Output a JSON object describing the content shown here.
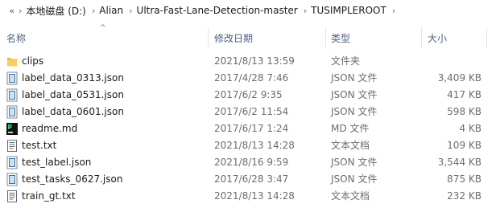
{
  "breadcrumb": {
    "start_glyph": "«",
    "separator": "›",
    "items": [
      "本地磁盘 (D:)",
      "Alian",
      "Ultra-Fast-Lane-Detection-master",
      "TUSIMPLEROOT"
    ],
    "chevron": "∨"
  },
  "columns": {
    "name": "名称",
    "date": "修改日期",
    "type": "类型",
    "size": "大小",
    "sort_glyph": "^"
  },
  "files": [
    {
      "name": "clips",
      "date": "2021/8/13 13:59",
      "type": "文件夹",
      "size": "",
      "icon": "folder-icon"
    },
    {
      "name": "label_data_0313.json",
      "date": "2017/4/28 7:46",
      "type": "JSON 文件",
      "size": "3,409 KB",
      "icon": "json-file-icon"
    },
    {
      "name": "label_data_0531.json",
      "date": "2017/6/2 9:35",
      "type": "JSON 文件",
      "size": "417 KB",
      "icon": "json-file-icon"
    },
    {
      "name": "label_data_0601.json",
      "date": "2017/6/2 11:54",
      "type": "JSON 文件",
      "size": "598 KB",
      "icon": "json-file-icon"
    },
    {
      "name": "readme.md",
      "date": "2017/6/17 1:24",
      "type": "MD 文件",
      "size": "4 KB",
      "icon": "pycharm-file-icon"
    },
    {
      "name": "test.txt",
      "date": "2021/8/13 14:28",
      "type": "文本文档",
      "size": "109 KB",
      "icon": "text-file-icon"
    },
    {
      "name": "test_label.json",
      "date": "2021/8/16 9:59",
      "type": "JSON 文件",
      "size": "3,544 KB",
      "icon": "json-file-icon"
    },
    {
      "name": "test_tasks_0627.json",
      "date": "2017/6/28 3:47",
      "type": "JSON 文件",
      "size": "875 KB",
      "icon": "json-file-icon"
    },
    {
      "name": "train_gt.txt",
      "date": "2021/8/13 14:28",
      "type": "文本文档",
      "size": "232 KB",
      "icon": "text-file-icon"
    }
  ]
}
